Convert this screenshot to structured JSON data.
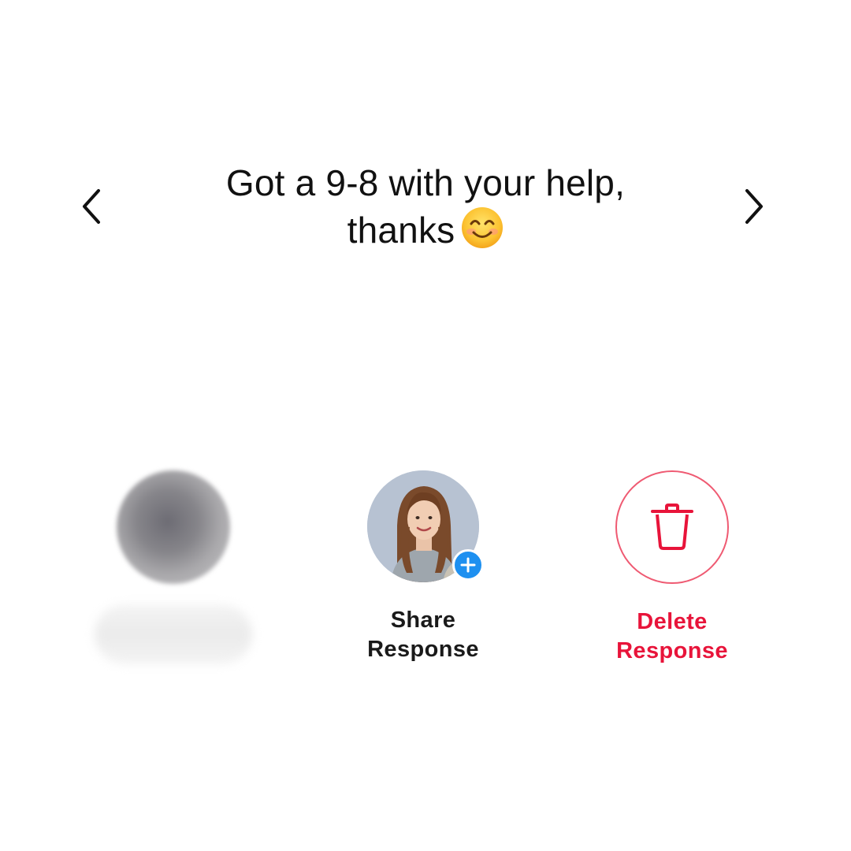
{
  "message": {
    "text": "Got a 9-8 with your help, thanks",
    "emoji": "smiling-face-icon"
  },
  "navigation": {
    "previous_icon": "chevron-left-icon",
    "next_icon": "chevron-right-icon"
  },
  "actions": {
    "share": {
      "line1": "Share",
      "line2": "Response",
      "badge_icon": "plus-icon"
    },
    "delete": {
      "line1": "Delete",
      "line2": "Response",
      "icon": "trash-icon"
    }
  },
  "colors": {
    "text": "#111111",
    "delete_accent": "#e8143a",
    "delete_ring": "#ef5a72",
    "badge": "#1e90f0"
  }
}
